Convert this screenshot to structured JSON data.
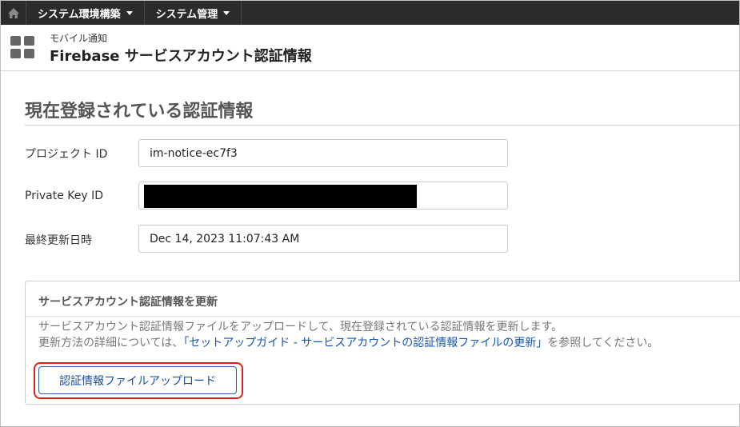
{
  "nav": {
    "home_icon": "home-icon",
    "menus": [
      {
        "label": "システム環境構築"
      },
      {
        "label": "システム管理"
      }
    ]
  },
  "header": {
    "app_icon": "grid-icon",
    "breadcrumb": "モバイル通知",
    "title": "Firebase サービスアカウント認証情報"
  },
  "section": {
    "title": "現在登録されている認証情報"
  },
  "fields": {
    "project_id": {
      "label": "プロジェクト ID",
      "value": "im-notice-ec7f3"
    },
    "private_key_id": {
      "label": "Private Key ID",
      "value": ""
    },
    "last_updated": {
      "label": "最終更新日時",
      "value": "Dec 14, 2023 11:07:43 AM"
    }
  },
  "update_panel": {
    "title": "サービスアカウント認証情報を更新",
    "description1": "サービスアカウント認証情報ファイルをアップロードして、現在登録されている認証情報を更新します。",
    "description2_prefix": "更新方法の詳細については、",
    "link_text": "「セットアップガイド - サービスアカウントの認証情報ファイルの更新」",
    "description2_suffix": "を参照してください。",
    "upload_button": "認証情報ファイルアップロード"
  },
  "colors": {
    "nav_bg": "#2b2b2b",
    "link": "#1a56a8",
    "button_border": "#2f62aa",
    "highlight": "#e11f1f"
  }
}
